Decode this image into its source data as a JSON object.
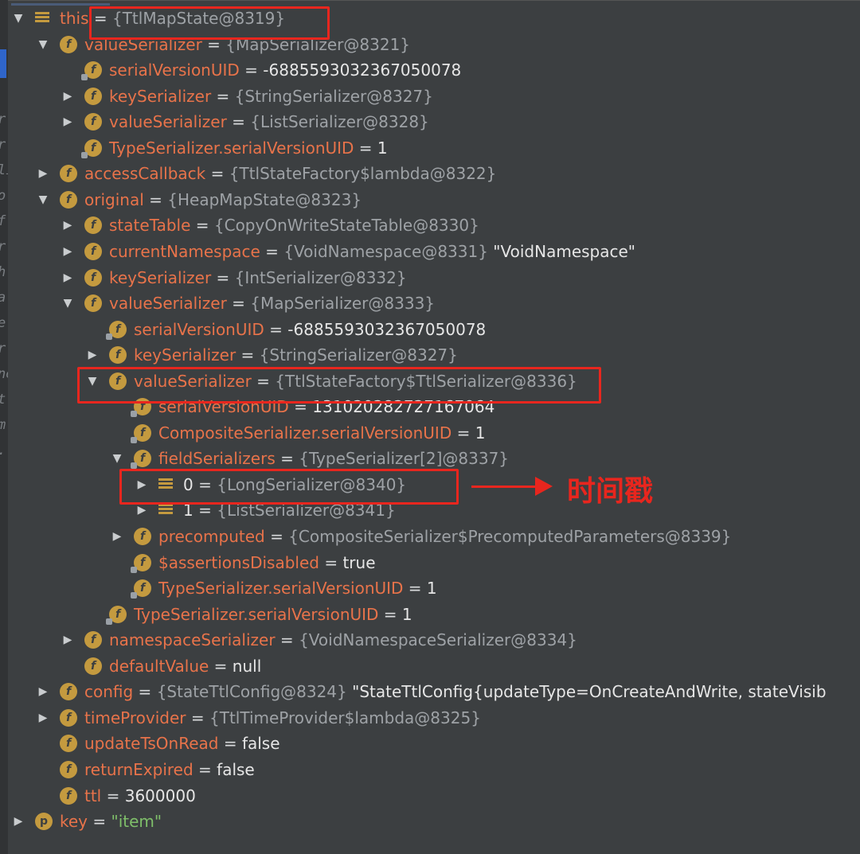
{
  "rows": [
    {
      "level": 0,
      "arrow": "down",
      "icon": "array",
      "name": "this",
      "eq": " = ",
      "ref": "{TtlMapState@8319}",
      "val": "",
      "kind": "ref"
    },
    {
      "level": 1,
      "arrow": "down",
      "icon": "f",
      "name": "valueSerializer",
      "eq": " = ",
      "ref": "{MapSerializer@8321}",
      "val": ""
    },
    {
      "level": 2,
      "arrow": "none",
      "icon": "f-lock",
      "name": "serialVersionUID",
      "eq": " = ",
      "ref": "",
      "val": "-6885593032367050078"
    },
    {
      "level": 2,
      "arrow": "right",
      "icon": "f",
      "name": "keySerializer",
      "eq": " = ",
      "ref": "{StringSerializer@8327}",
      "val": ""
    },
    {
      "level": 2,
      "arrow": "right",
      "icon": "f",
      "name": "valueSerializer",
      "eq": " = ",
      "ref": "{ListSerializer@8328}",
      "val": ""
    },
    {
      "level": 2,
      "arrow": "none",
      "icon": "f-lock",
      "name": "TypeSerializer.serialVersionUID",
      "eq": " = ",
      "ref": "",
      "val": "1"
    },
    {
      "level": 1,
      "arrow": "right",
      "icon": "f",
      "name": "accessCallback",
      "eq": " = ",
      "ref": "{TtlStateFactory$lambda@8322}",
      "val": ""
    },
    {
      "level": 1,
      "arrow": "down",
      "icon": "f",
      "name": "original",
      "eq": " = ",
      "ref": "{HeapMapState@8323}",
      "val": ""
    },
    {
      "level": 2,
      "arrow": "right",
      "icon": "f",
      "name": "stateTable",
      "eq": " = ",
      "ref": "{CopyOnWriteStateTable@8330}",
      "val": ""
    },
    {
      "level": 2,
      "arrow": "right",
      "icon": "f",
      "name": "currentNamespace",
      "eq": " = ",
      "ref": "{VoidNamespace@8331}",
      "val": " \"VoidNamespace\""
    },
    {
      "level": 2,
      "arrow": "right",
      "icon": "f",
      "name": "keySerializer",
      "eq": " = ",
      "ref": "{IntSerializer@8332}",
      "val": ""
    },
    {
      "level": 2,
      "arrow": "down",
      "icon": "f",
      "name": "valueSerializer",
      "eq": " = ",
      "ref": "{MapSerializer@8333}",
      "val": ""
    },
    {
      "level": 3,
      "arrow": "none",
      "icon": "f-lock",
      "name": "serialVersionUID",
      "eq": " = ",
      "ref": "",
      "val": "-6885593032367050078"
    },
    {
      "level": 3,
      "arrow": "right",
      "icon": "f",
      "name": "keySerializer",
      "eq": " = ",
      "ref": "{StringSerializer@8327}",
      "val": ""
    },
    {
      "level": 3,
      "arrow": "down",
      "icon": "f",
      "name": "valueSerializer",
      "eq": " = ",
      "ref": "{TtlStateFactory$TtlSerializer@8336}",
      "val": ""
    },
    {
      "level": 4,
      "arrow": "none",
      "icon": "f-lock",
      "name": "serialVersionUID",
      "eq": " = ",
      "ref": "",
      "val": "131020282727167064"
    },
    {
      "level": 4,
      "arrow": "none",
      "icon": "f-lock",
      "name": "CompositeSerializer.serialVersionUID",
      "eq": " = ",
      "ref": "",
      "val": "1"
    },
    {
      "level": 4,
      "arrow": "down",
      "icon": "f-lock",
      "name": "fieldSerializers",
      "eq": " = ",
      "ref": "{TypeSerializer[2]@8337}",
      "val": ""
    },
    {
      "level": 5,
      "arrow": "right",
      "icon": "array",
      "name": "0",
      "eq": " = ",
      "ref": "{LongSerializer@8340}",
      "val": "",
      "plain": true
    },
    {
      "level": 5,
      "arrow": "right",
      "icon": "array",
      "name": "1",
      "eq": " = ",
      "ref": "{ListSerializer@8341}",
      "val": "",
      "plain": true
    },
    {
      "level": 4,
      "arrow": "right",
      "icon": "f",
      "name": "precomputed",
      "eq": " = ",
      "ref": "{CompositeSerializer$PrecomputedParameters@8339}",
      "val": ""
    },
    {
      "level": 4,
      "arrow": "none",
      "icon": "f-lock",
      "name": "$assertionsDisabled",
      "eq": " = ",
      "ref": "",
      "val": "true"
    },
    {
      "level": 4,
      "arrow": "none",
      "icon": "f-lock",
      "name": "TypeSerializer.serialVersionUID",
      "eq": " = ",
      "ref": "",
      "val": "1"
    },
    {
      "level": 3,
      "arrow": "none",
      "icon": "f-lock",
      "name": "TypeSerializer.serialVersionUID",
      "eq": " = ",
      "ref": "",
      "val": "1"
    },
    {
      "level": 2,
      "arrow": "right",
      "icon": "f",
      "name": "namespaceSerializer",
      "eq": " = ",
      "ref": "{VoidNamespaceSerializer@8334}",
      "val": ""
    },
    {
      "level": 2,
      "arrow": "none",
      "icon": "f",
      "name": "defaultValue",
      "eq": " = ",
      "ref": "",
      "val": "null"
    },
    {
      "level": 1,
      "arrow": "right",
      "icon": "f",
      "name": "config",
      "eq": " = ",
      "ref": "{StateTtlConfig@8324}",
      "val": " \"StateTtlConfig{updateType=OnCreateAndWrite, stateVisib"
    },
    {
      "level": 1,
      "arrow": "right",
      "icon": "f",
      "name": "timeProvider",
      "eq": " = ",
      "ref": "{TtlTimeProvider$lambda@8325}",
      "val": ""
    },
    {
      "level": 1,
      "arrow": "none",
      "icon": "f",
      "name": "updateTsOnRead",
      "eq": " = ",
      "ref": "",
      "val": "false"
    },
    {
      "level": 1,
      "arrow": "none",
      "icon": "f",
      "name": "returnExpired",
      "eq": " = ",
      "ref": "",
      "val": "false"
    },
    {
      "level": 1,
      "arrow": "none",
      "icon": "f",
      "name": "ttl",
      "eq": " = ",
      "ref": "",
      "val": "3600000"
    },
    {
      "level": 0,
      "arrow": "right",
      "icon": "p",
      "name": "key",
      "eq": " = ",
      "ref": "",
      "val": "\"item\"",
      "string": true
    }
  ],
  "icon_letters": {
    "f": "f",
    "p": "p"
  },
  "gutter_glyphs": [
    "r.",
    "r.",
    "li",
    "o",
    "f",
    "r",
    "h",
    "a",
    "e.",
    "r",
    "ne",
    "t",
    "m",
    "."
  ],
  "annotation": {
    "label": "时间戳",
    "color": "#e8261e"
  },
  "colors": {
    "background": "#3c3f41",
    "field_name": "#e8734a",
    "reference": "#9ea2a6",
    "value": "#e6e6e6",
    "icon": "#c49a3f",
    "highlight": "#e8261e"
  }
}
